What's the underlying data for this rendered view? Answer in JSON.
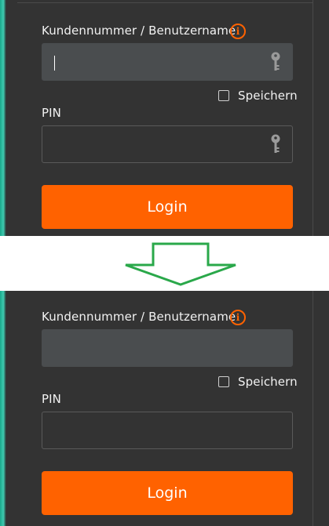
{
  "login_form": {
    "customer_label": "Kundennummer / Benutzername",
    "info_icon_glyph": "i",
    "remember_label": "Speichern",
    "pin_label": "PIN",
    "login_button": "Login"
  },
  "icons": {
    "info": "info-circle-icon",
    "key": "key-icon",
    "transition": "down-arrow-icon"
  },
  "colors": {
    "panel_background": "#333333",
    "accent_orange": "#ff6200",
    "arrow_green": "#2aa84a",
    "input_filled": "#4a4d4f"
  }
}
